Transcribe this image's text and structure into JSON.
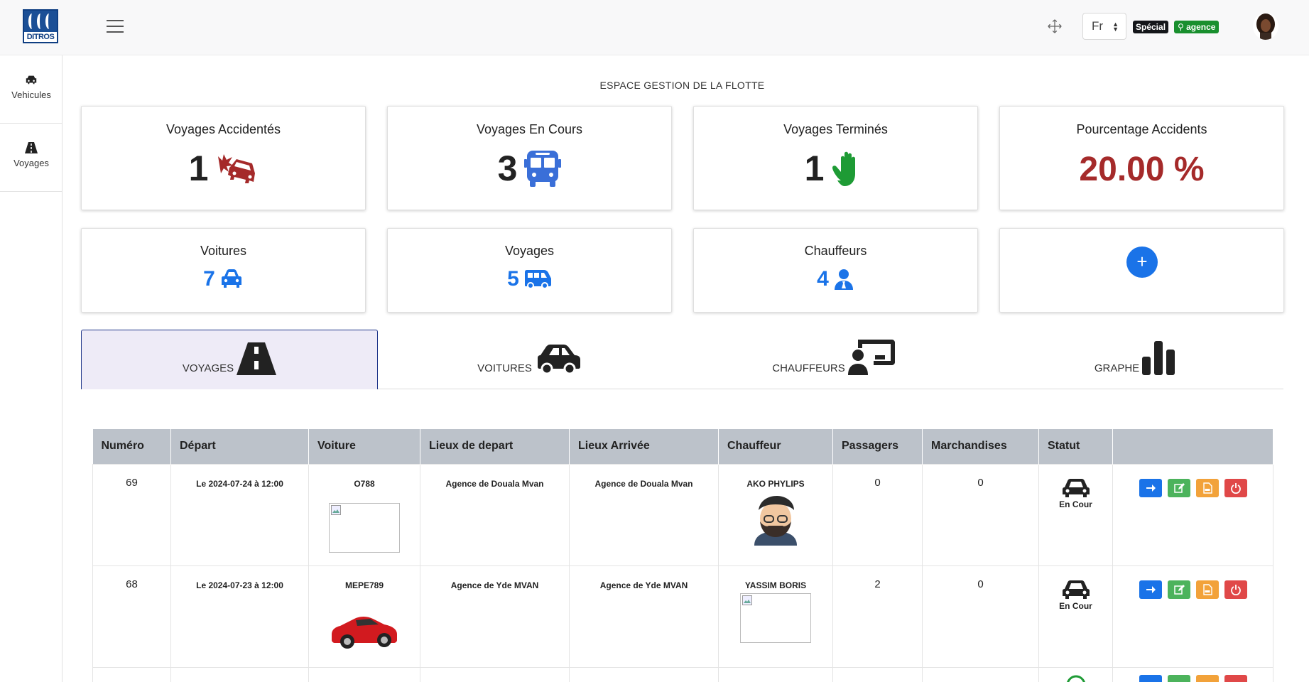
{
  "header": {
    "logo_text": "DITROS",
    "lang": "Fr",
    "badge_special": "Spécial",
    "badge_agence": "agence"
  },
  "sidebar": {
    "items": [
      {
        "label": "Vehicules",
        "icon": "car-icon"
      },
      {
        "label": "Voyages",
        "icon": "road-icon"
      }
    ]
  },
  "page": {
    "title": "ESPACE GESTION DE LA FLOTTE"
  },
  "stats_top": [
    {
      "title": "Voyages Accidentés",
      "value": "1",
      "icon": "car-crash-icon",
      "icon_color": "#a52a2a"
    },
    {
      "title": "Voyages En Cours",
      "value": "3",
      "icon": "bus-icon",
      "icon_color": "#3a6fd8"
    },
    {
      "title": "Voyages Terminés",
      "value": "1",
      "icon": "hand-icon",
      "icon_color": "#1e9b35"
    },
    {
      "title": "Pourcentage Accidents",
      "value": "20.00 %"
    }
  ],
  "stats_bottom": [
    {
      "title": "Voitures",
      "value": "7",
      "icon": "car-icon"
    },
    {
      "title": "Voyages",
      "value": "5",
      "icon": "van-icon"
    },
    {
      "title": "Chauffeurs",
      "value": "4",
      "icon": "user-tie-icon"
    }
  ],
  "add_button": "+",
  "tabs": [
    {
      "label": "VOYAGES",
      "icon": "road-icon",
      "active": true
    },
    {
      "label": "VOITURES",
      "icon": "car-side-icon",
      "active": false
    },
    {
      "label": "CHAUFFEURS",
      "icon": "chalkboard-user-icon",
      "active": false
    },
    {
      "label": "GRAPHE",
      "icon": "bar-chart-icon",
      "active": false
    }
  ],
  "table": {
    "headers": [
      "Numéro",
      "Départ",
      "Voiture",
      "Lieux de depart",
      "Lieux Arrivée",
      "Chauffeur",
      "Passagers",
      "Marchandises",
      "Statut",
      ""
    ],
    "rows": [
      {
        "numero": "69",
        "depart": "Le 2024-07-24 à 12:00",
        "voiture": "O788",
        "lieu_depart": "Agence de Douala Mvan",
        "lieu_arrivee": "Agence de Douala Mvan",
        "chauffeur": "AKO PHYLIPS",
        "passagers": "0",
        "marchandises": "0",
        "statut": "En Cour"
      },
      {
        "numero": "68",
        "depart": "Le 2024-07-23 à 12:00",
        "voiture": "MEPE789",
        "lieu_depart": "Agence de Yde MVAN",
        "lieu_arrivee": "Agence de Yde MVAN",
        "chauffeur": "YASSIM BORIS",
        "passagers": "2",
        "marchandises": "0",
        "statut": "En Cour"
      }
    ]
  },
  "colors": {
    "primary": "#1a73e8",
    "danger": "#a52a2a",
    "success": "#1e9b35",
    "table_header": "#bcc2ca"
  }
}
